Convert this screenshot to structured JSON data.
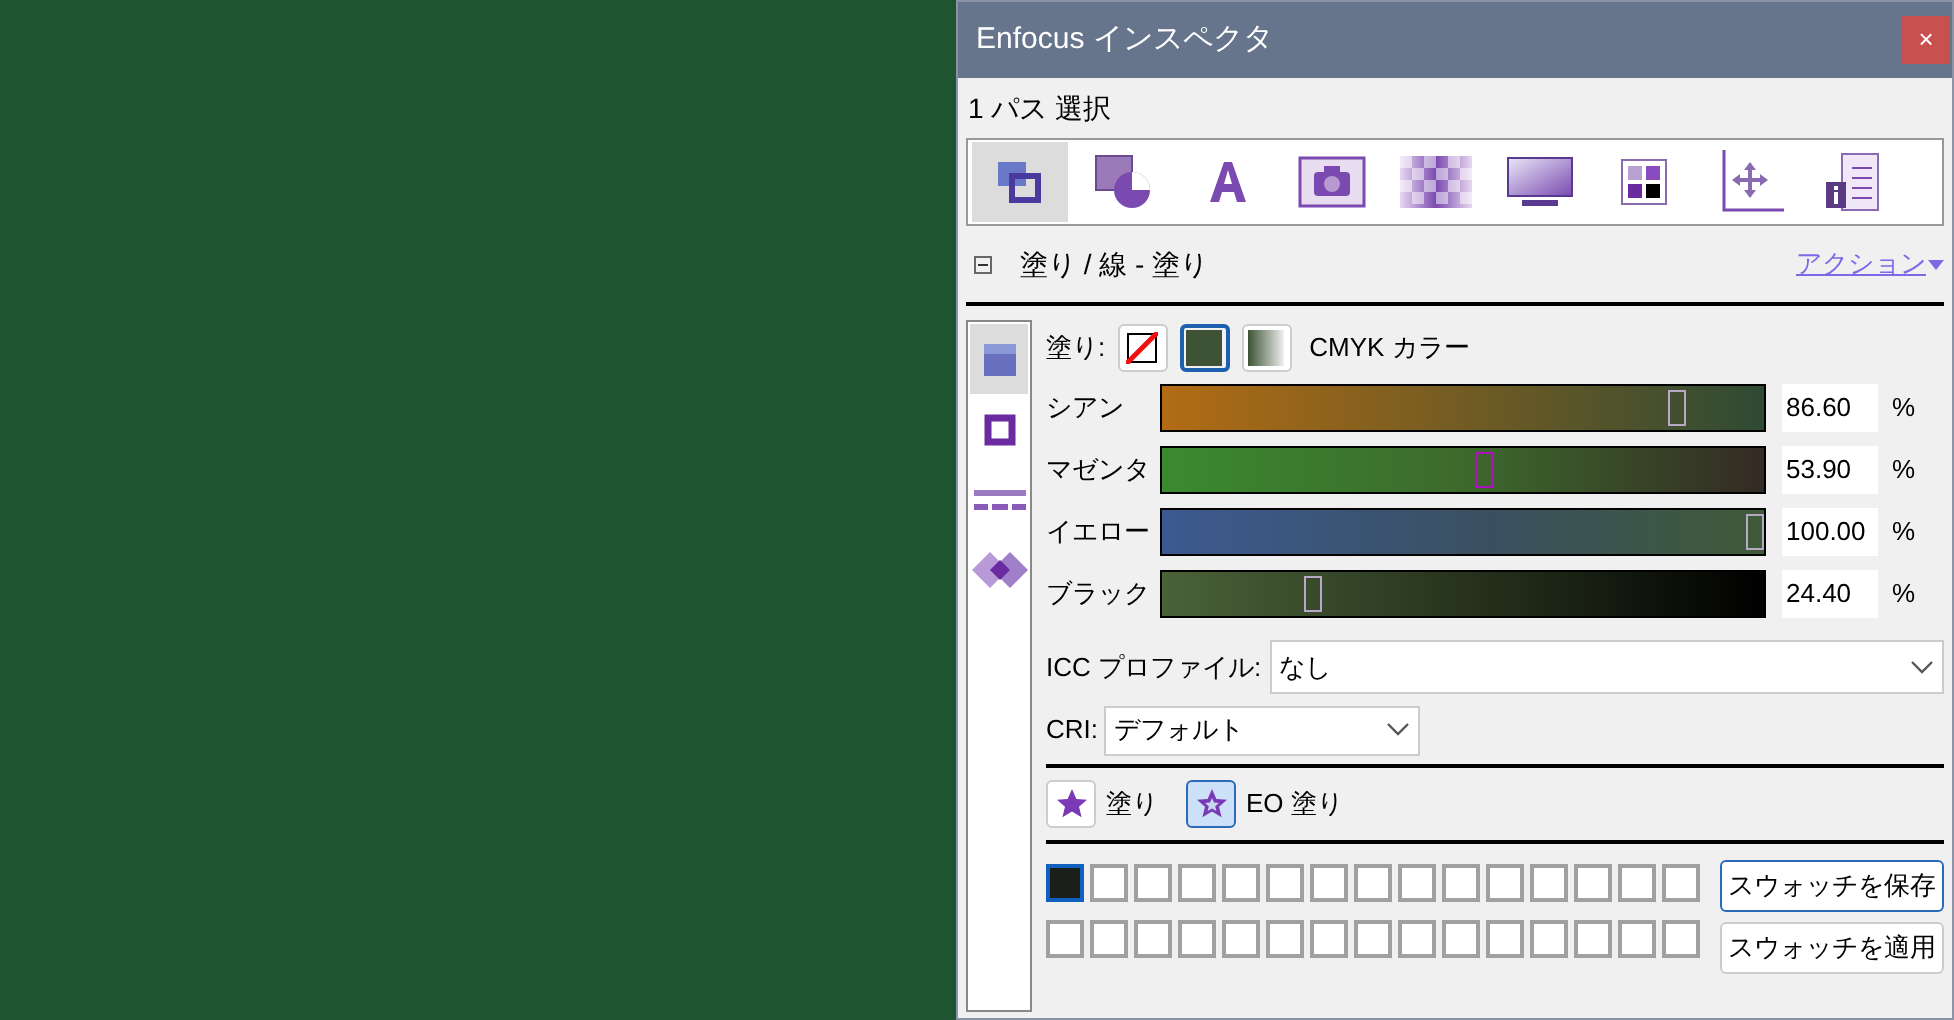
{
  "window": {
    "title": "Enfocus インスペクタ",
    "close": "×"
  },
  "selection": "1 パス 選択",
  "toolbar": [
    {
      "kind": "fillstroke",
      "selected": true
    },
    {
      "kind": "shape",
      "selected": false
    },
    {
      "kind": "text",
      "selected": false
    },
    {
      "kind": "image",
      "selected": false
    },
    {
      "kind": "transparency",
      "selected": false
    },
    {
      "kind": "display",
      "selected": false
    },
    {
      "kind": "grid",
      "selected": false
    },
    {
      "kind": "position",
      "selected": false
    },
    {
      "kind": "info",
      "selected": false
    }
  ],
  "section": {
    "expanded": true,
    "title": "塗り / 線 - 塗り",
    "action": "アクション"
  },
  "sidebar": [
    {
      "kind": "fill",
      "selected": true
    },
    {
      "kind": "stroke",
      "selected": false
    },
    {
      "kind": "dash",
      "selected": false
    },
    {
      "kind": "overprint",
      "selected": false
    }
  ],
  "fill": {
    "label": "塗り:",
    "types": [
      {
        "kind": "none",
        "selected": false
      },
      {
        "kind": "solid",
        "selected": true
      },
      {
        "kind": "gradient",
        "selected": false
      }
    ],
    "mode": "CMYK カラー"
  },
  "channels": [
    {
      "name": "シアン",
      "level": 0.866,
      "value": "86.60",
      "unit": "%"
    },
    {
      "name": "マゼンタ",
      "level": 0.539,
      "value": "53.90",
      "unit": "%"
    },
    {
      "name": "イエロー",
      "level": 1,
      "value": "100.00",
      "unit": "%"
    },
    {
      "name": "ブラック",
      "level": 0.244,
      "value": "24.40",
      "unit": "%"
    }
  ],
  "icc": {
    "label": "ICC プロファイル:",
    "value": "なし"
  },
  "cri": {
    "label": "CRI:",
    "value": "デフォルト"
  },
  "fill_rules": [
    {
      "label": "塗り",
      "selected": false
    },
    {
      "label": "EO 塗り",
      "selected": true
    }
  ],
  "swatches": [
    [
      {
        "selected": true
      },
      {
        "selected": false
      },
      {
        "selected": false
      },
      {
        "selected": false
      },
      {
        "selected": false
      },
      {
        "selected": false
      },
      {
        "selected": false
      },
      {
        "selected": false
      },
      {
        "selected": false
      },
      {
        "selected": false
      },
      {
        "selected": false
      },
      {
        "selected": false
      },
      {
        "selected": false
      },
      {
        "selected": false
      },
      {
        "selected": false
      }
    ],
    [
      {
        "selected": false
      },
      {
        "selected": false
      },
      {
        "selected": false
      },
      {
        "selected": false
      },
      {
        "selected": false
      },
      {
        "selected": false
      },
      {
        "selected": false
      },
      {
        "selected": false
      },
      {
        "selected": false
      },
      {
        "selected": false
      },
      {
        "selected": false
      },
      {
        "selected": false
      },
      {
        "selected": false
      },
      {
        "selected": false
      },
      {
        "selected": false
      }
    ]
  ],
  "swatch_buttons": [
    "スウォッチを保存",
    "スウォッチを適用"
  ]
}
